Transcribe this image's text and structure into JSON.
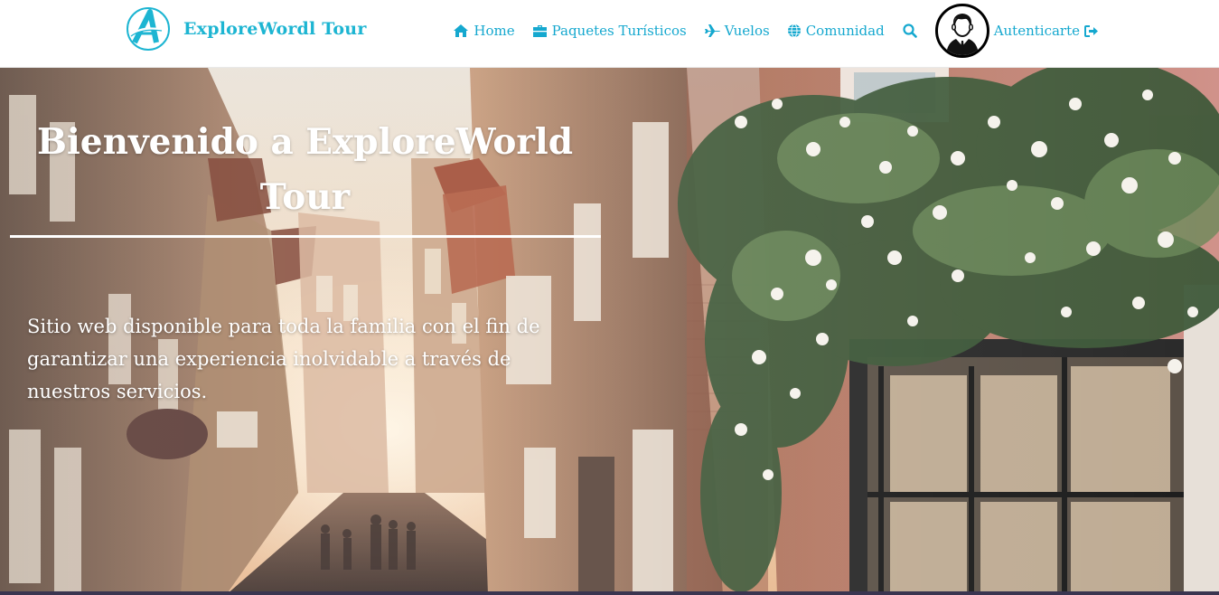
{
  "brand": {
    "name": "ExploreWordl Tour",
    "logo_icon": "letter-a-compass-logo",
    "color": "#1db5d2"
  },
  "nav": {
    "accent_color": "#15a8cf",
    "items": [
      {
        "label": "Home",
        "icon": "home-icon"
      },
      {
        "label": "Paquetes Turísticos",
        "icon": "briefcase-icon"
      },
      {
        "label": "Vuelos",
        "icon": "plane-icon"
      },
      {
        "label": "Comunidad",
        "icon": "globe-icon"
      }
    ],
    "search_icon": "search-icon",
    "avatar_icon": "user-avatar-icon",
    "auth": {
      "label": "Autenticarte",
      "icon": "sign-in-icon"
    }
  },
  "hero": {
    "title": "Bienvenido a ExploreWorld Tour",
    "text": "Sitio web disponible para toda la familia con el fin de garantizar una experiencia inolvidable a través de nuestros servicios.",
    "background": "street-with-flower-covered-houses-photo"
  }
}
